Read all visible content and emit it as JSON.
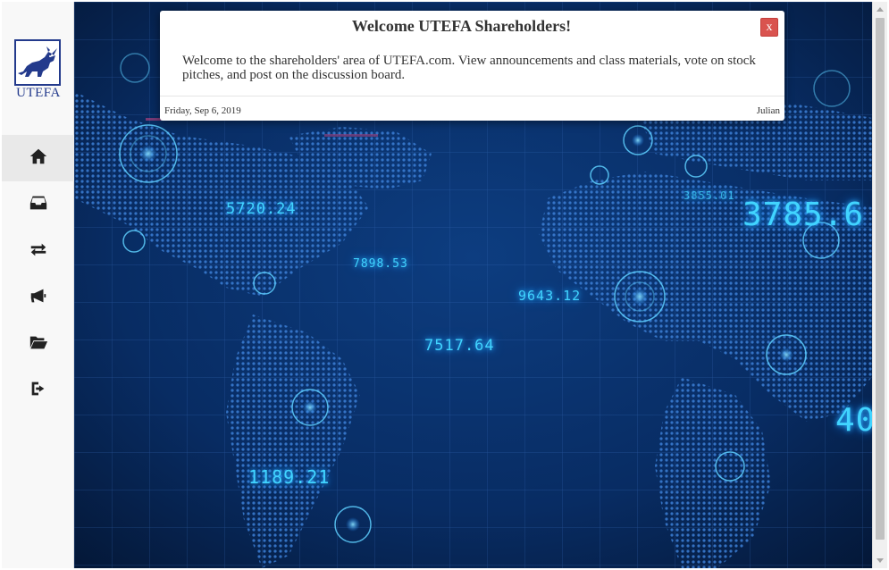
{
  "brand": {
    "logo_text": "UTEFA",
    "logo_icon": "bull-logo-icon",
    "color": "#233a8c"
  },
  "sidebar": {
    "items": [
      {
        "icon": "home-icon",
        "active": true
      },
      {
        "icon": "inbox-icon",
        "active": false
      },
      {
        "icon": "exchange-icon",
        "active": false
      },
      {
        "icon": "bullhorn-icon",
        "active": false
      },
      {
        "icon": "folder-open-icon",
        "active": false
      },
      {
        "icon": "sign-out-icon",
        "active": false
      }
    ]
  },
  "background": {
    "tickers": [
      "5720.24",
      "7898.53",
      "9643.12",
      "7517.64",
      "1189.21",
      "3855.01",
      "3785.6",
      "40"
    ]
  },
  "modal": {
    "title": "Welcome UTEFA Shareholders!",
    "close_label": "x",
    "body": "Welcome to the shareholders' area of UTEFA.com. View announcements and class materials, vote on stock pitches, and post on the discussion board.",
    "date": "Friday, Sep 6, 2019",
    "author": "Julian",
    "close_color": "#d9534f"
  }
}
